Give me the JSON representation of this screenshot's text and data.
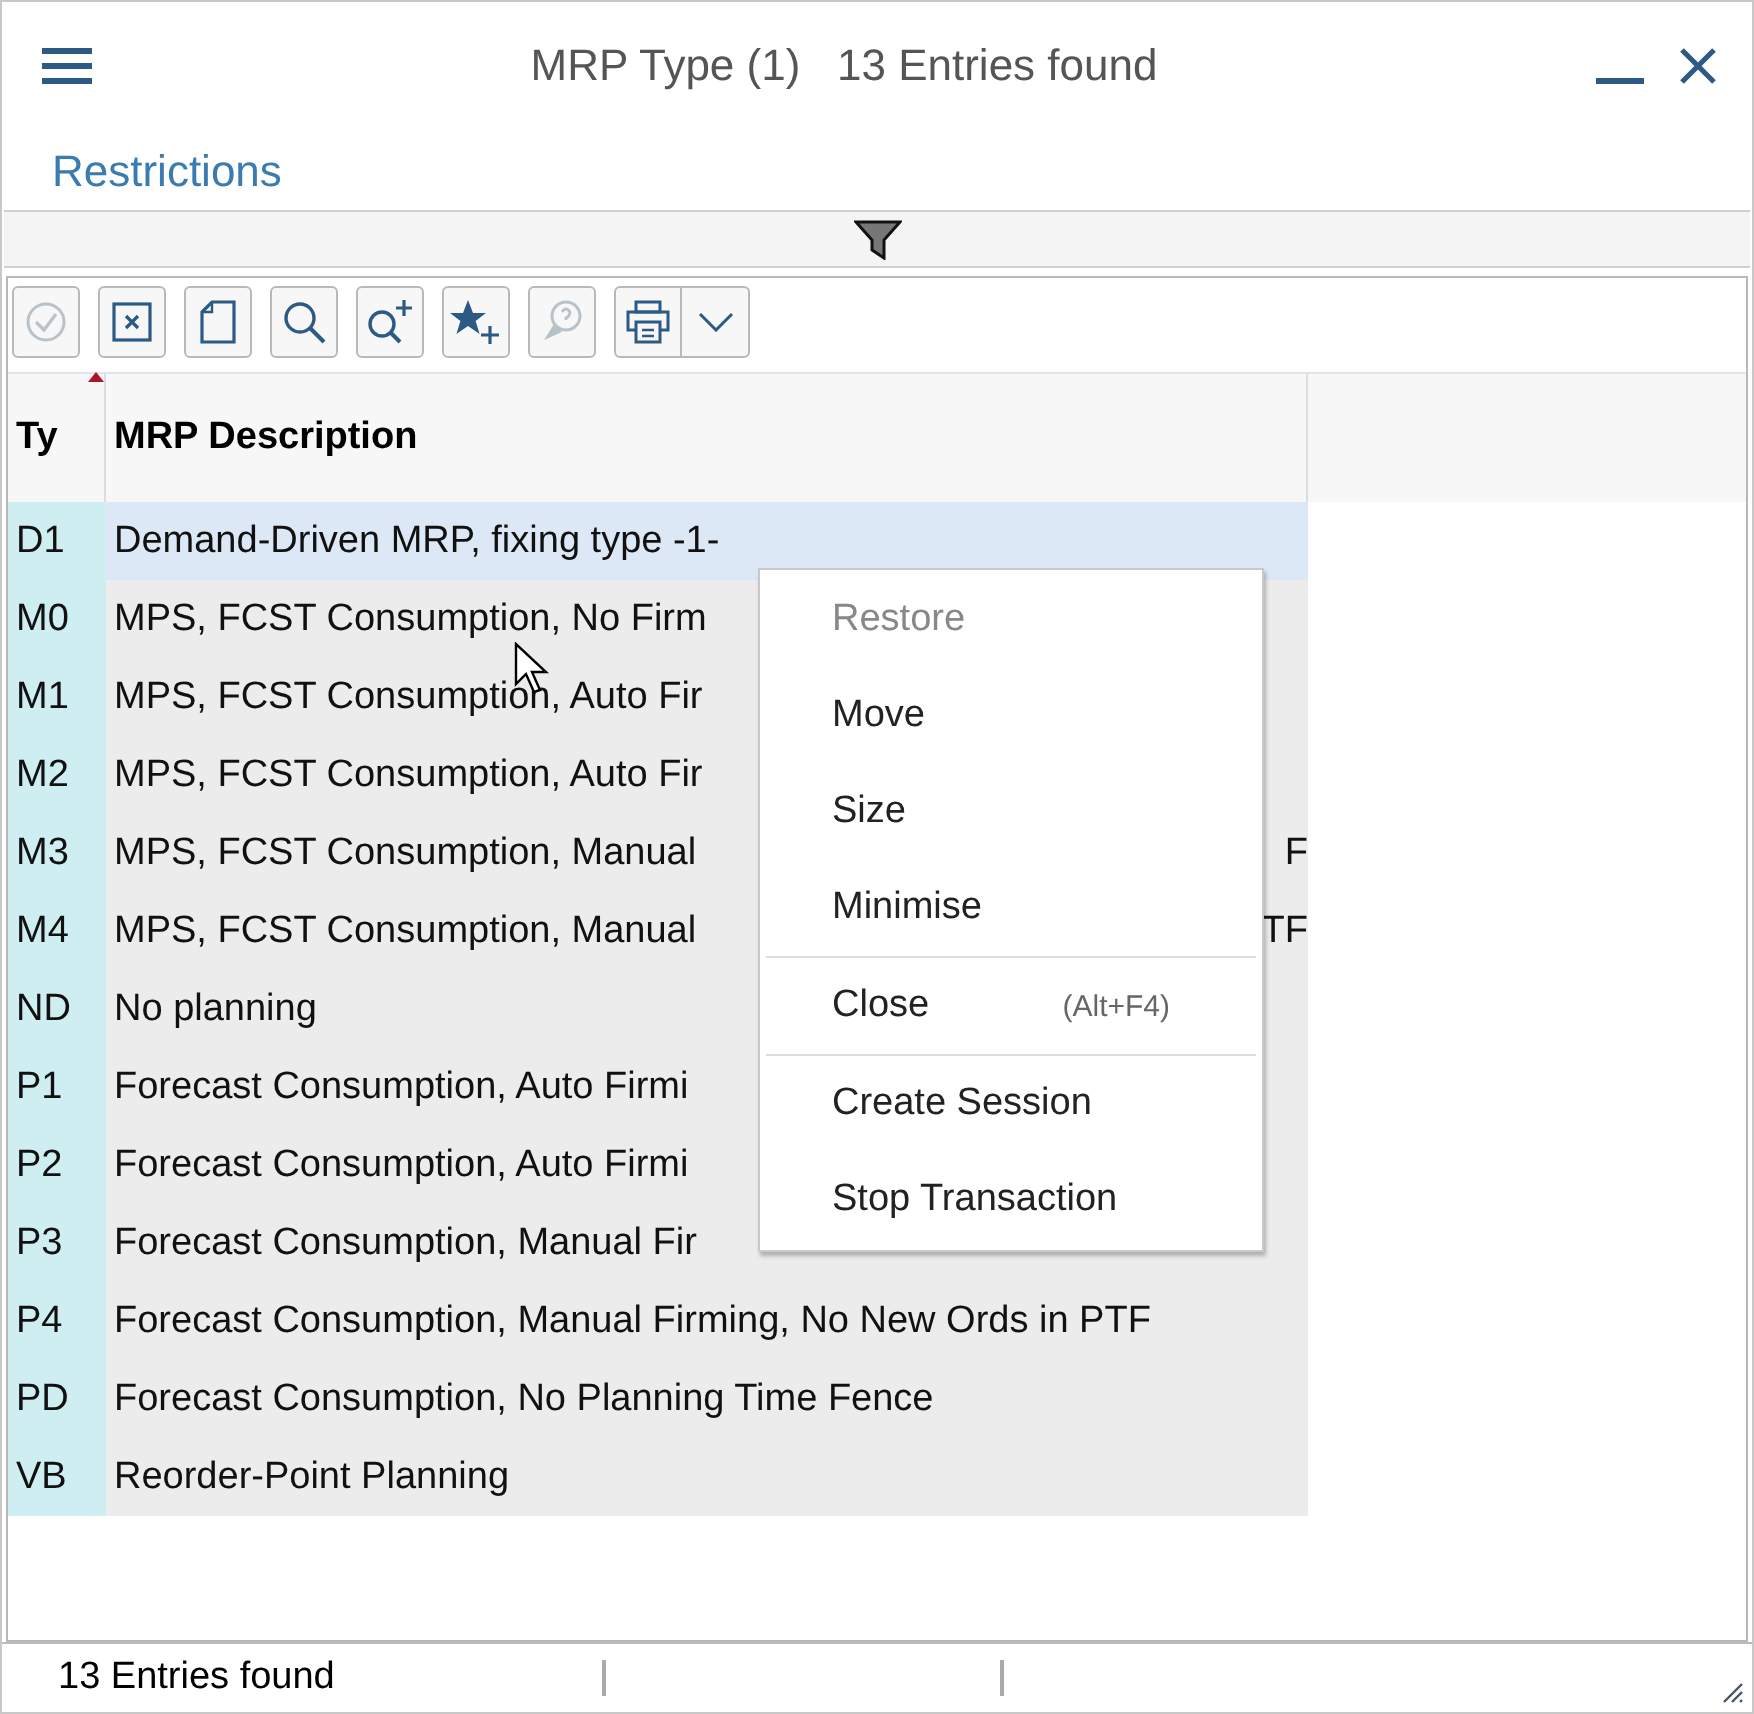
{
  "window": {
    "title": "MRP Type (1)   13 Entries found"
  },
  "restrictions_link": "Restrictions",
  "toolbar": [
    {
      "kind": "check",
      "disabled": true
    },
    {
      "kind": "cancel",
      "disabled": false
    },
    {
      "kind": "page",
      "disabled": false
    },
    {
      "kind": "search",
      "disabled": false
    },
    {
      "kind": "search_more",
      "disabled": false
    },
    {
      "kind": "favorite",
      "disabled": false
    },
    {
      "kind": "help",
      "disabled": true
    },
    {
      "kind": "print",
      "disabled": false
    },
    {
      "kind": "dropdown",
      "disabled": false
    }
  ],
  "table": {
    "columns": [
      "Ty",
      "MRP Description"
    ],
    "rows": [
      {
        "type": "D1",
        "description": "Demand-Driven MRP, fixing type -1-",
        "selected": true
      },
      {
        "type": "M0",
        "description": "MPS, FCST Consumption, No Firm",
        "selected": false
      },
      {
        "type": "M1",
        "description": "MPS, FCST Consumption, Auto Fir",
        "selected": false
      },
      {
        "type": "M2",
        "description": "MPS, FCST Consumption, Auto Fir",
        "selected": false
      },
      {
        "type": "M3",
        "description": "MPS, FCST Consumption, Manual",
        "tail": "F",
        "selected": false
      },
      {
        "type": "M4",
        "description": "MPS, FCST Consumption, Manual",
        "tail": "TF",
        "selected": false
      },
      {
        "type": "ND",
        "description": "No planning",
        "selected": false
      },
      {
        "type": "P1",
        "description": "Forecast Consumption, Auto Firmi",
        "selected": false
      },
      {
        "type": "P2",
        "description": "Forecast Consumption, Auto Firmi",
        "selected": false
      },
      {
        "type": "P3",
        "description": "Forecast Consumption, Manual Fir",
        "selected": false
      },
      {
        "type": "P4",
        "description": "Forecast Consumption, Manual Firming, No New Ords in PTF",
        "selected": false
      },
      {
        "type": "PD",
        "description": "Forecast Consumption, No Planning Time Fence",
        "selected": false
      },
      {
        "type": "VB",
        "description": "Reorder-Point Planning",
        "selected": false
      }
    ]
  },
  "context_menu": [
    {
      "label": "Restore",
      "disabled": true
    },
    {
      "label": "Move",
      "disabled": false
    },
    {
      "label": "Size",
      "disabled": false
    },
    {
      "label": "Minimise",
      "disabled": false,
      "separator_after": true
    },
    {
      "label": "Close",
      "shortcut": "(Alt+F4)",
      "disabled": false,
      "separator_after": true
    },
    {
      "label": "Create Session",
      "disabled": false
    },
    {
      "label": "Stop Transaction",
      "disabled": false
    }
  ],
  "status_bar": "13 Entries found"
}
